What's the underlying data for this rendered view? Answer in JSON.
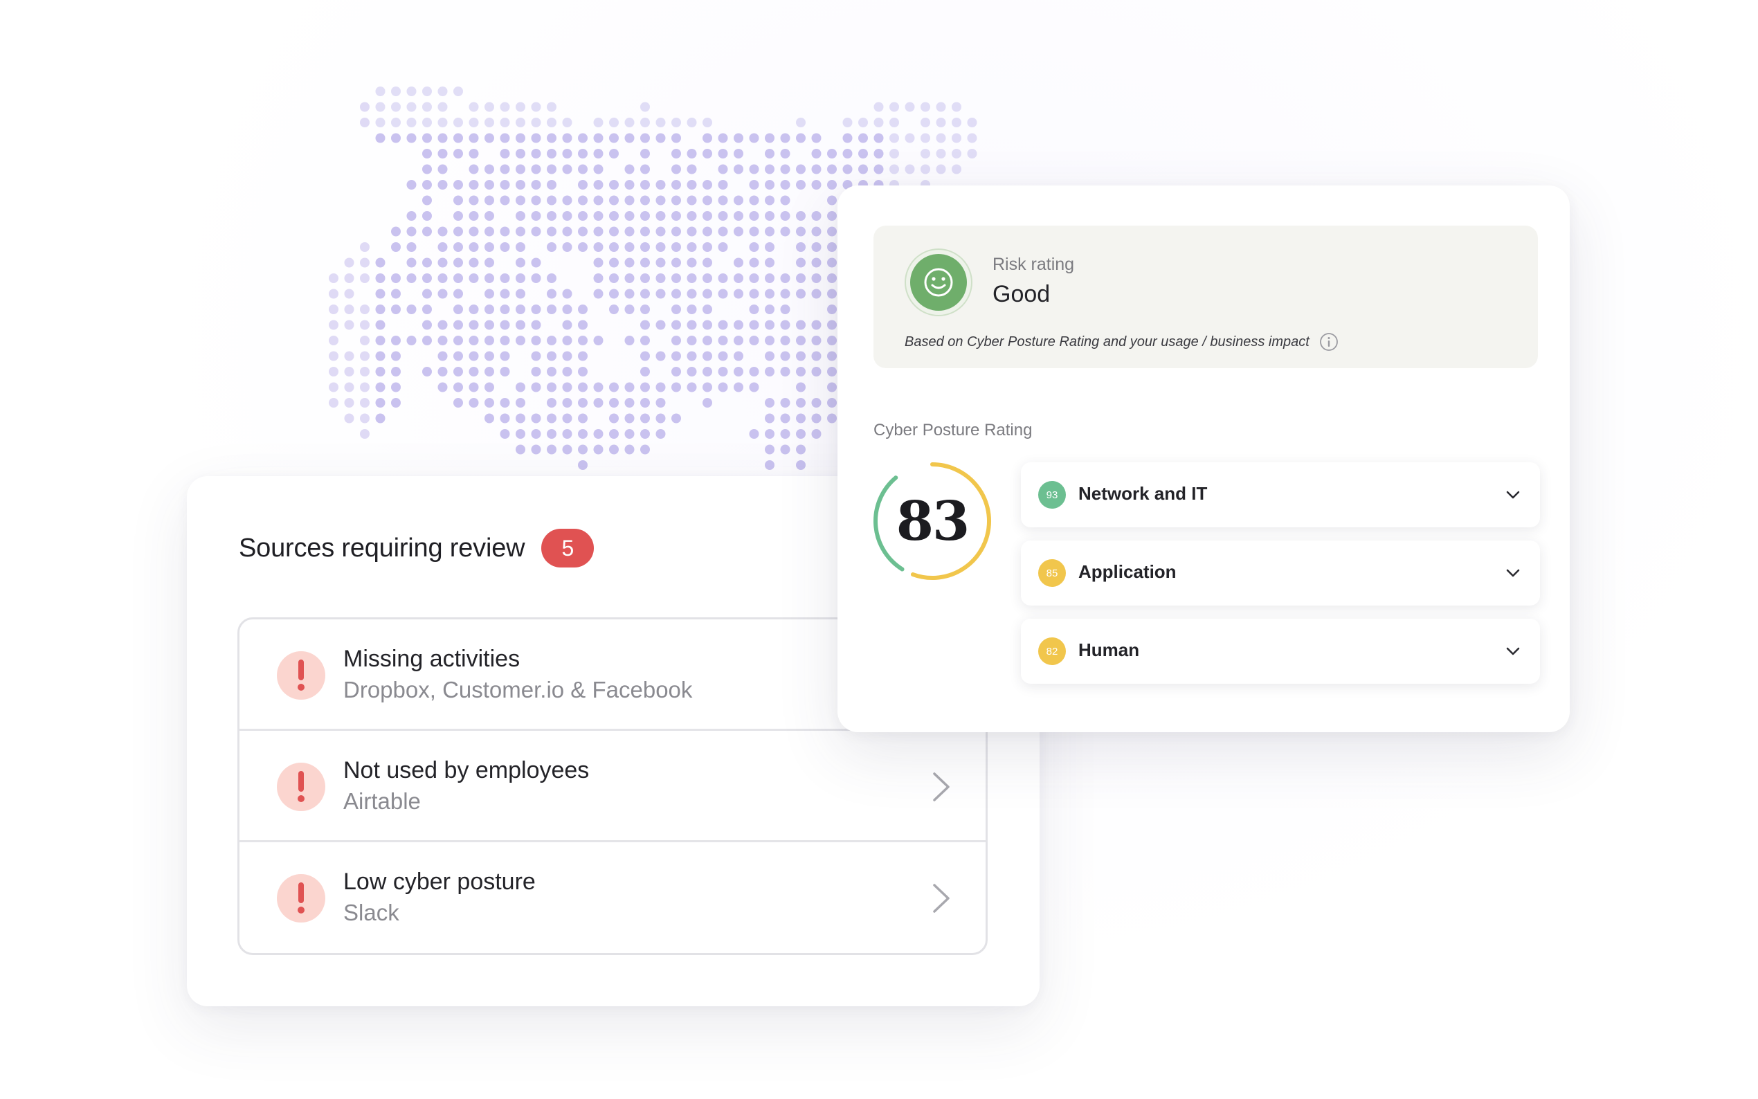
{
  "colors": {
    "dot": "#c9c2ef",
    "alert": "#e05252",
    "alert_bg": "#fbd5cf",
    "good": "#6fae6b",
    "score_green": "#6cbf91",
    "score_yellow": "#f1c64c"
  },
  "sources": {
    "title": "Sources requiring review",
    "count": "5",
    "items": [
      {
        "title": "Missing activities",
        "subtitle": "Dropbox, Customer.io & Facebook",
        "icon": "exclamation-icon"
      },
      {
        "title": "Not used by employees",
        "subtitle": "Airtable",
        "icon": "exclamation-icon"
      },
      {
        "title": "Low cyber posture",
        "subtitle": "Slack",
        "icon": "exclamation-icon"
      }
    ]
  },
  "risk": {
    "label": "Risk rating",
    "value": "Good",
    "note": "Based on Cyber Posture Rating and your usage / business impact",
    "icon": "smiley-icon"
  },
  "cyber_posture": {
    "heading": "Cyber Posture Rating",
    "score": "83",
    "score_fraction": 0.83,
    "categories": [
      {
        "score": "93",
        "label": "Network and IT",
        "color": "#6cbf91"
      },
      {
        "score": "85",
        "label": "Application",
        "color": "#f1c64c"
      },
      {
        "score": "82",
        "label": "Human",
        "color": "#f1c64c"
      }
    ]
  }
}
